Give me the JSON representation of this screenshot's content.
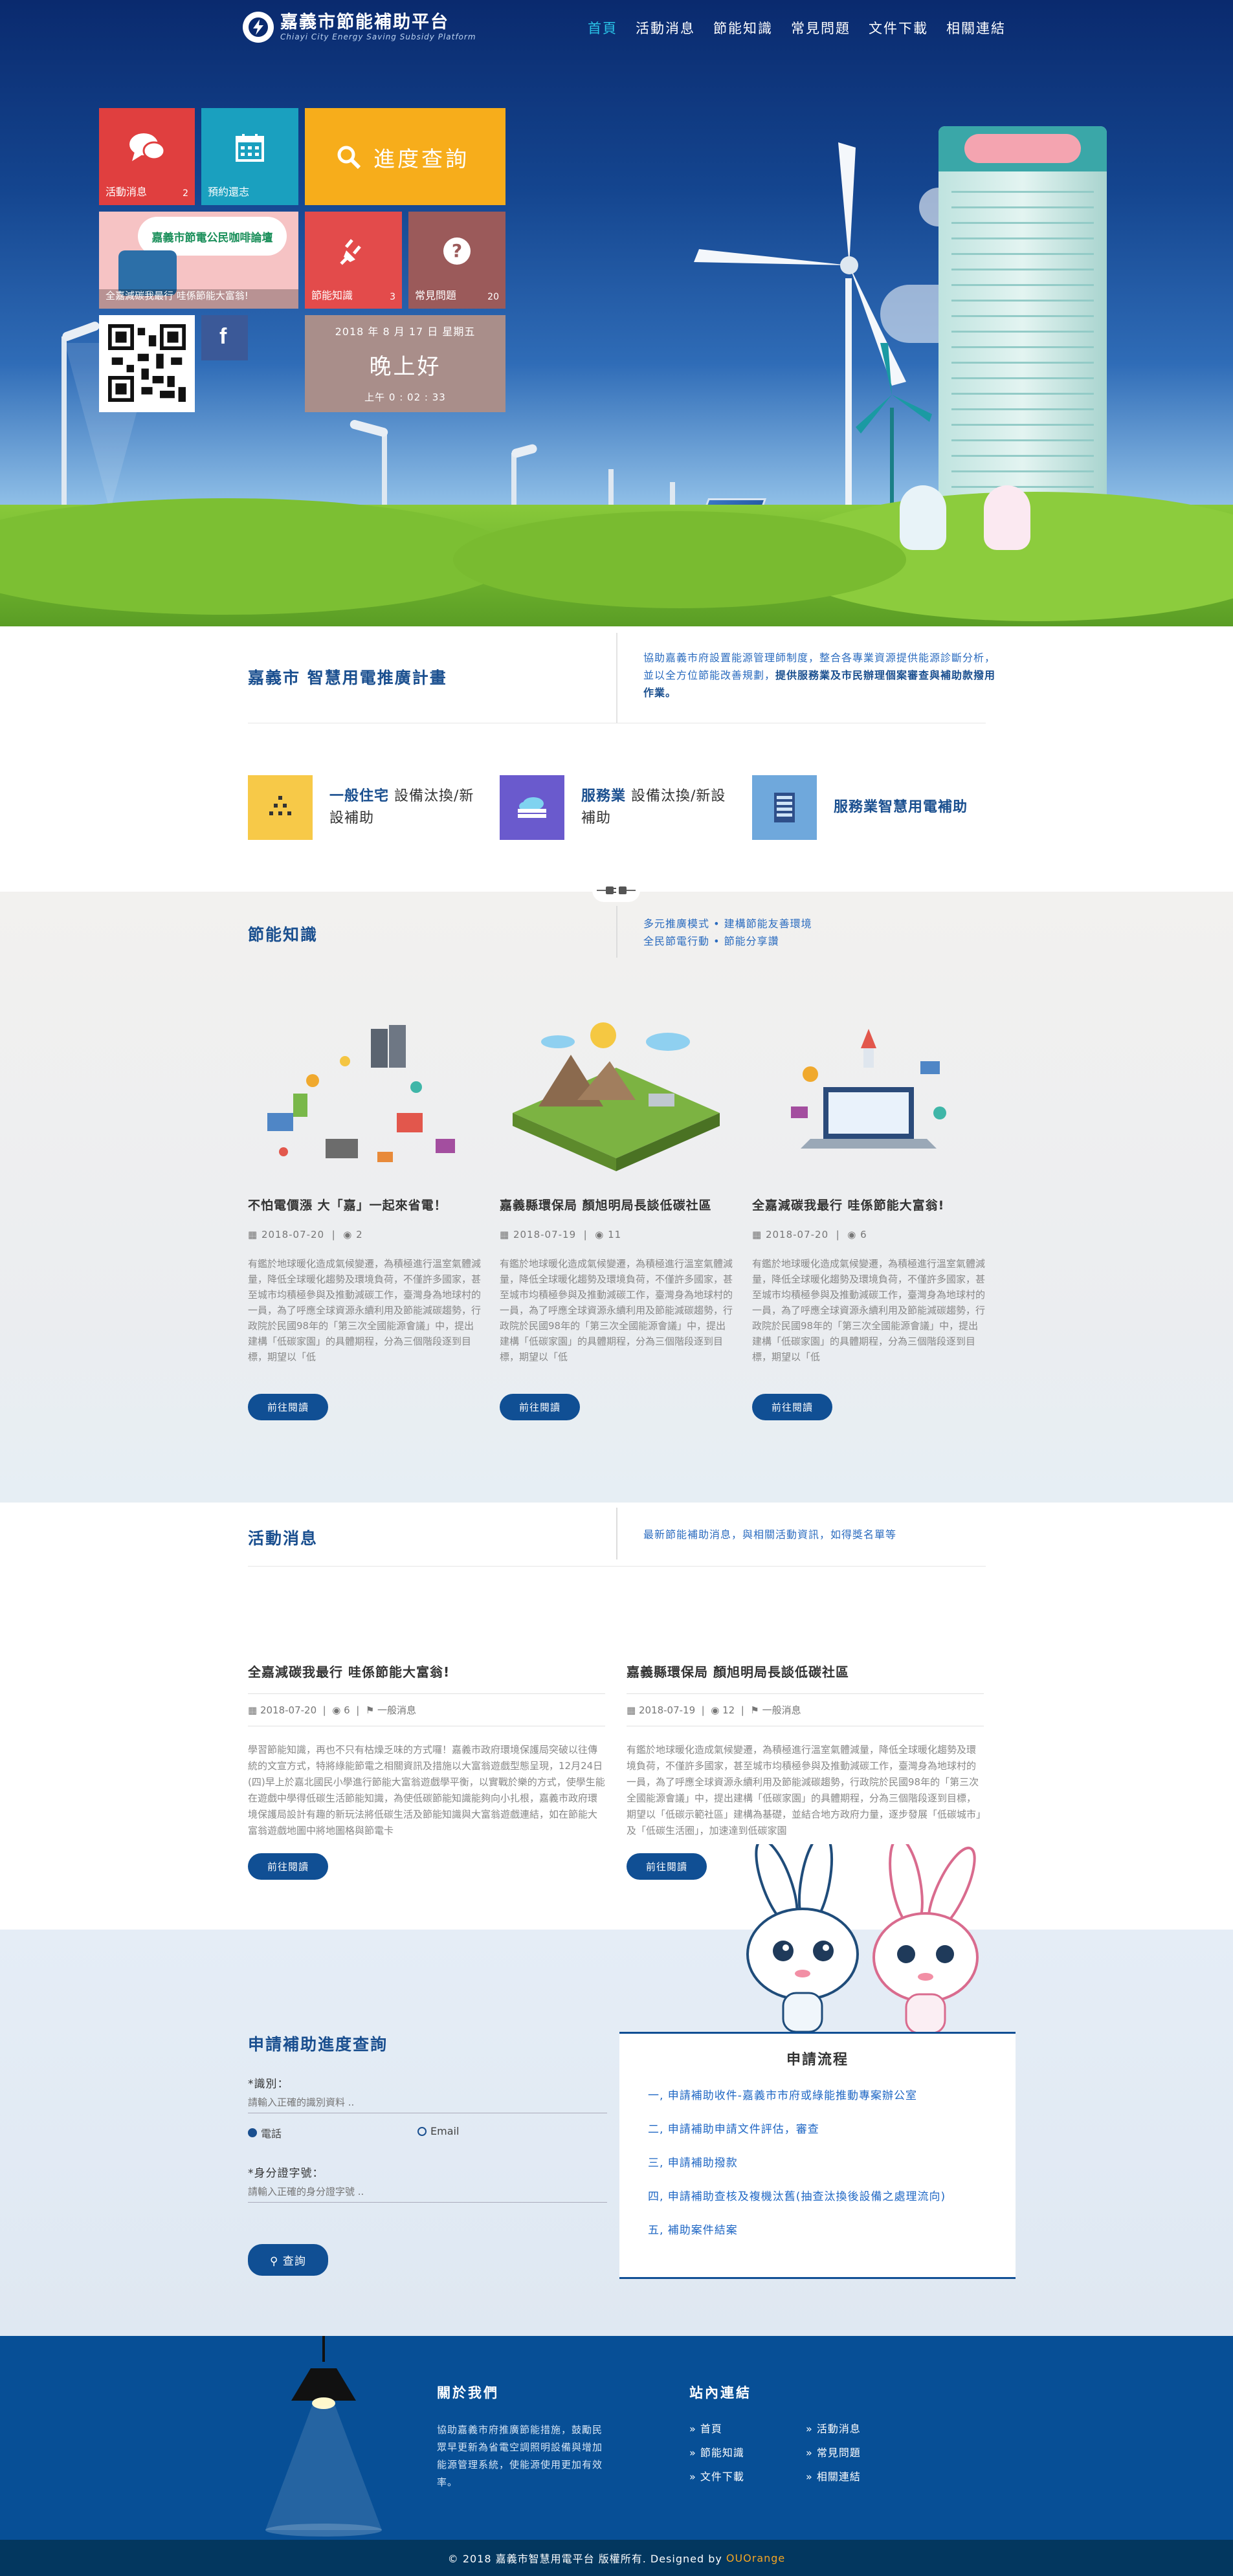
{
  "header": {
    "logo_title": "嘉義市節能補助平台",
    "logo_subtitle": "Chiayi City Energy Saving Subsidy Platform",
    "nav": [
      "首頁",
      "活動消息",
      "節能知識",
      "常見問題",
      "文件下載",
      "相關連結"
    ],
    "active_nav": "首頁"
  },
  "tiles": {
    "news": {
      "label": "活動消息",
      "count": "2",
      "color": "#e03f3f"
    },
    "calendar": {
      "label": "預約還志",
      "color": "#1aa0bf"
    },
    "progress": {
      "label": "進度查詢",
      "color": "#f7ad1b"
    },
    "banner": {
      "label": "全嘉減碳我最行 哇係節能大富翁!",
      "banner_text": "嘉義市節電公民咖啡論壇"
    },
    "knowledge": {
      "label": "節能知識",
      "count": "3",
      "color": "#e34b4b"
    },
    "faq": {
      "label": "常見問題",
      "count": "20",
      "color": "#9b5a5a"
    },
    "facebook": {
      "label": "f",
      "color": "#3b5998"
    },
    "clock": {
      "date": "2018 年 8 月 17 日 星期五",
      "greeting": "晚上好",
      "time": "上午 0 : 02 : 33"
    }
  },
  "plan": {
    "title": "嘉義市 智慧用電推廣計畫",
    "desc_plain": "協助嘉義市府設置能源管理師制度，整合各專業資源提供能源診斷分析，並以全方位節能改善規劃，",
    "desc_bold": "提供服務業及市民辦理個案審查與補助款撥用作業。"
  },
  "services": [
    {
      "bold": "一般住宅",
      "rest": " 設備汰換/新設補助",
      "color": "#f7c948"
    },
    {
      "bold": "服務業",
      "rest": " 設備汰換/新設 補助",
      "color": "#6a5acd"
    },
    {
      "bold": "服務業智慧用電補助",
      "rest": "",
      "color": "#6fa8dc"
    }
  ],
  "knowledge": {
    "title": "節能知識",
    "desc_line1": "多元推廣模式 • 建構節能友善環境",
    "desc_line2": "全民節電行動 • 節能分享讚",
    "cards": [
      {
        "title": "不怕電價漲 大「嘉」一起來省電！",
        "date": "2018-07-20",
        "views": "2",
        "body": "有鑑於地球暖化造成氣候變遷，為積極進行溫室氣體減量，降低全球暖化趨勢及環境負荷，不僅許多國家，甚至城市均積極參與及推動減碳工作，臺灣身為地球村的一員，為了呼應全球資源永續利用及節能減碳趨勢，行政院於民國98年的「第三次全國能源會議」中，提出建構「低碳家園」的具體期程，分為三個階段逐到目標，期望以「低",
        "button": "前往閱讀"
      },
      {
        "title": "嘉義縣環保局 顏旭明局長談低碳社區",
        "date": "2018-07-19",
        "views": "11",
        "body": "有鑑於地球暖化造成氣候變遷，為積極進行溫室氣體減量，降低全球暖化趨勢及環境負荷，不僅許多國家，甚至城市均積極參與及推動減碳工作，臺灣身為地球村的一員，為了呼應全球資源永續利用及節能減碳趨勢，行政院於民國98年的「第三次全國能源會議」中，提出建構「低碳家園」的具體期程，分為三個階段逐到目標，期望以「低",
        "button": "前往閱讀"
      },
      {
        "title": "全嘉減碳我最行 哇係節能大富翁!",
        "date": "2018-07-20",
        "views": "6",
        "body": "有鑑於地球暖化造成氣候變遷，為積極進行溫室氣體減量，降低全球暖化趨勢及環境負荷，不僅許多國家，甚至城市均積極參與及推動減碳工作，臺灣身為地球村的一員，為了呼應全球資源永續利用及節能減碳趨勢，行政院於民國98年的「第三次全國能源會議」中，提出建構「低碳家園」的具體期程，分為三個階段逐到目標，期望以「低",
        "button": "前往閱讀"
      }
    ]
  },
  "activities": {
    "title": "活動消息",
    "desc": "最新節能補助消息，與相關活動資訊，如得獎名單等",
    "posts": [
      {
        "title": "全嘉減碳我最行 哇係節能大富翁!",
        "date": "2018-07-20",
        "views": "6",
        "category": "一般消息",
        "body": "學習節能知識，再也不只有枯燥乏味的方式囉！嘉義市政府環境保護局突破以往傳統的文宣方式，特將綠能節電之相關資訊及措施以大富翁遊戲型態呈現，12月24日(四)早上於嘉北國民小學進行節能大富翁遊戲學平衡，以實戰於樂的方式，使學生能在遊戲中學得低碳生活節能知識，為使低碳節能知識能夠向小扎根，嘉義市政府環境保護局設計有趣的新玩法將低碳生活及節能知識與大富翁遊戲連結，如在節能大富翁遊戲地圖中將地圖格與節電卡",
        "button": "前往閱讀"
      },
      {
        "title": "嘉義縣環保局 顏旭明局長談低碳社區",
        "date": "2018-07-19",
        "views": "12",
        "category": "一般消息",
        "body": "有鑑於地球暖化造成氣候變遷，為積極進行溫室氣體減量，降低全球暖化趨勢及環境負荷，不僅許多國家，甚至城市均積極參與及推動減碳工作，臺灣身為地球村的一員，為了呼應全球資源永續利用及節能減碳趨勢，行政院於民國98年的「第三次全國能源會議」中，提出建構「低碳家園」的具體期程，分為三個階段逐到目標，期望以「低碳示範社區」建構為基礎，並結合地方政府力量，逐步發展「低碳城市」及「低碳生活圈」，加速達到低碳家園",
        "button": "前往閱讀"
      }
    ]
  },
  "query": {
    "title": "申請補助進度查詢",
    "id_label": "*識別：",
    "id_placeholder": "請輸入正確的識別資料 ..",
    "radio_phone": "電話",
    "radio_email": "Email",
    "idcard_label": "*身分證字號：",
    "idcard_placeholder": "請輸入正確的身分證字號 ..",
    "button": "查詢"
  },
  "flow": {
    "title": "申請流程",
    "items": [
      "一, 申請補助收件-嘉義市市府或綠能推動專案辦公室",
      "二, 申請補助申請文件評估，審查",
      "三, 申請補助撥款",
      "四, 申請補助查核及複機汰舊(抽查汰換後設備之處理流向)",
      "五, 補助案件結案"
    ]
  },
  "footer": {
    "about_title": "關於我們",
    "about_text": "協助嘉義市府推廣節能措施，鼓勵民眾早更新為省電空調照明設備與增加能源管理系統，使能源使用更加有效率。",
    "links_title": "站內連結",
    "links": [
      "首頁",
      "活動消息",
      "節能知識",
      "常見問題",
      "文件下載",
      "相關連結"
    ],
    "copyright": "© 2018 嘉義市智慧用電平台 版權所有. Designed by",
    "designer": "OUOrange"
  }
}
